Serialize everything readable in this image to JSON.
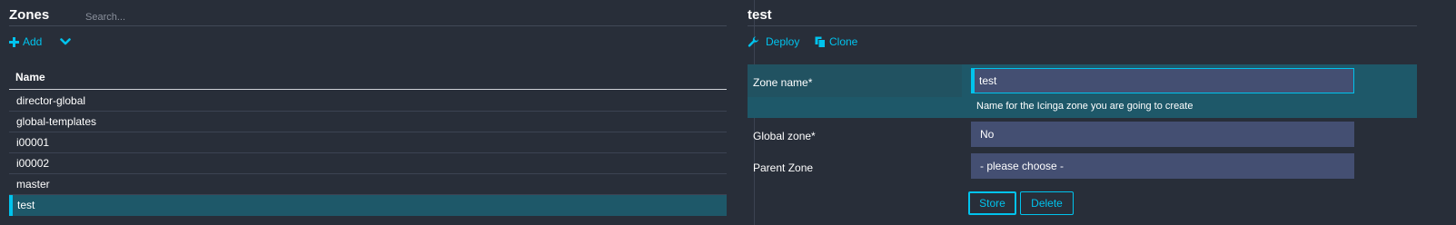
{
  "left": {
    "title": "Zones",
    "search_placeholder": "Search...",
    "add_label": "Add",
    "table": {
      "column_header": "Name",
      "rows": [
        "director-global",
        "global-templates",
        "i00001",
        "i00002",
        "master",
        "test"
      ],
      "selected_index": 5
    }
  },
  "right": {
    "title": "test",
    "actions": {
      "deploy": "Deploy",
      "clone": "Clone"
    },
    "form": {
      "zone_name_label": "Zone name*",
      "zone_name_value": "test",
      "zone_name_hint": "Name for the Icinga zone you are going to create",
      "global_zone_label": "Global zone*",
      "global_zone_value": "No",
      "parent_zone_label": "Parent Zone",
      "parent_zone_value": "- please choose -",
      "store_label": "Store",
      "delete_label": "Delete"
    }
  },
  "colors": {
    "background": "#282e39",
    "accent": "#00c3ed",
    "selected_row": "#1e5869",
    "input": "#444f72"
  },
  "icons": {
    "add": "plus-icon",
    "expand": "chevron-down-icon",
    "deploy": "wrench-icon",
    "clone": "copy-icon"
  }
}
